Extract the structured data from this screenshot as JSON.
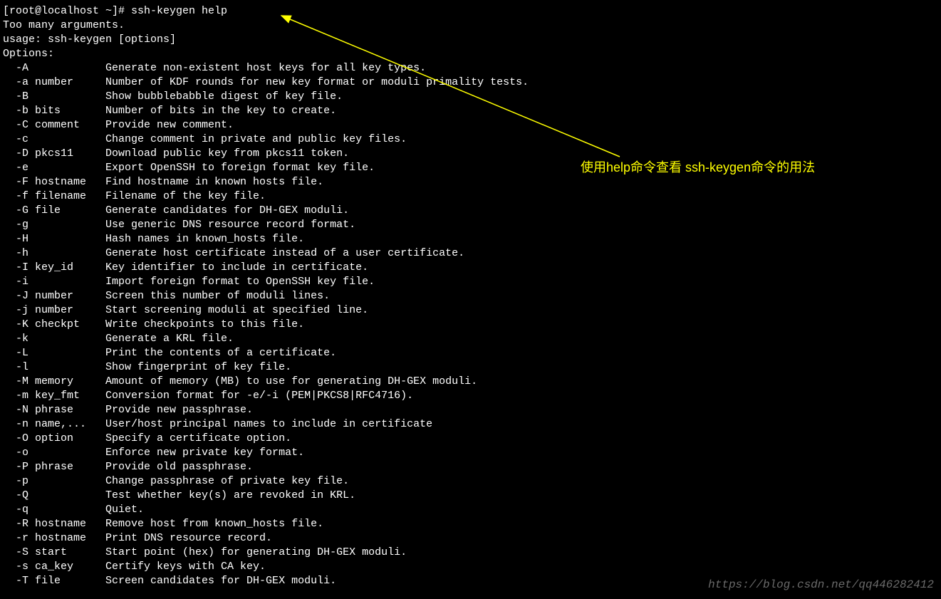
{
  "prompt": "[root@localhost ~]# ",
  "command": "ssh-keygen help",
  "err": "Too many arguments.",
  "usage": "usage: ssh-keygen [options]",
  "optheader": "Options:",
  "options": [
    {
      "flag": "-A",
      "arg": "",
      "desc": "Generate non-existent host keys for all key types."
    },
    {
      "flag": "-a",
      "arg": "number",
      "desc": "Number of KDF rounds for new key format or moduli primality tests."
    },
    {
      "flag": "-B",
      "arg": "",
      "desc": "Show bubblebabble digest of key file."
    },
    {
      "flag": "-b",
      "arg": "bits",
      "desc": "Number of bits in the key to create."
    },
    {
      "flag": "-C",
      "arg": "comment",
      "desc": "Provide new comment."
    },
    {
      "flag": "-c",
      "arg": "",
      "desc": "Change comment in private and public key files."
    },
    {
      "flag": "-D",
      "arg": "pkcs11",
      "desc": "Download public key from pkcs11 token."
    },
    {
      "flag": "-e",
      "arg": "",
      "desc": "Export OpenSSH to foreign format key file."
    },
    {
      "flag": "-F",
      "arg": "hostname",
      "desc": "Find hostname in known hosts file."
    },
    {
      "flag": "-f",
      "arg": "filename",
      "desc": "Filename of the key file."
    },
    {
      "flag": "-G",
      "arg": "file",
      "desc": "Generate candidates for DH-GEX moduli."
    },
    {
      "flag": "-g",
      "arg": "",
      "desc": "Use generic DNS resource record format."
    },
    {
      "flag": "-H",
      "arg": "",
      "desc": "Hash names in known_hosts file."
    },
    {
      "flag": "-h",
      "arg": "",
      "desc": "Generate host certificate instead of a user certificate."
    },
    {
      "flag": "-I",
      "arg": "key_id",
      "desc": "Key identifier to include in certificate."
    },
    {
      "flag": "-i",
      "arg": "",
      "desc": "Import foreign format to OpenSSH key file."
    },
    {
      "flag": "-J",
      "arg": "number",
      "desc": "Screen this number of moduli lines."
    },
    {
      "flag": "-j",
      "arg": "number",
      "desc": "Start screening moduli at specified line."
    },
    {
      "flag": "-K",
      "arg": "checkpt",
      "desc": "Write checkpoints to this file."
    },
    {
      "flag": "-k",
      "arg": "",
      "desc": "Generate a KRL file."
    },
    {
      "flag": "-L",
      "arg": "",
      "desc": "Print the contents of a certificate."
    },
    {
      "flag": "-l",
      "arg": "",
      "desc": "Show fingerprint of key file."
    },
    {
      "flag": "-M",
      "arg": "memory",
      "desc": "Amount of memory (MB) to use for generating DH-GEX moduli."
    },
    {
      "flag": "-m",
      "arg": "key_fmt",
      "desc": "Conversion format for -e/-i (PEM|PKCS8|RFC4716)."
    },
    {
      "flag": "-N",
      "arg": "phrase",
      "desc": "Provide new passphrase."
    },
    {
      "flag": "-n",
      "arg": "name,...",
      "desc": "User/host principal names to include in certificate"
    },
    {
      "flag": "-O",
      "arg": "option",
      "desc": "Specify a certificate option."
    },
    {
      "flag": "-o",
      "arg": "",
      "desc": "Enforce new private key format."
    },
    {
      "flag": "-P",
      "arg": "phrase",
      "desc": "Provide old passphrase."
    },
    {
      "flag": "-p",
      "arg": "",
      "desc": "Change passphrase of private key file."
    },
    {
      "flag": "-Q",
      "arg": "",
      "desc": "Test whether key(s) are revoked in KRL."
    },
    {
      "flag": "-q",
      "arg": "",
      "desc": "Quiet."
    },
    {
      "flag": "-R",
      "arg": "hostname",
      "desc": "Remove host from known_hosts file."
    },
    {
      "flag": "-r",
      "arg": "hostname",
      "desc": "Print DNS resource record."
    },
    {
      "flag": "-S",
      "arg": "start",
      "desc": "Start point (hex) for generating DH-GEX moduli."
    },
    {
      "flag": "-s",
      "arg": "ca_key",
      "desc": "Certify keys with CA key."
    },
    {
      "flag": "-T",
      "arg": "file",
      "desc": "Screen candidates for DH-GEX moduli."
    }
  ],
  "annotation": "使用help命令查看 ssh-keygen命令的用法",
  "watermark": "https://blog.csdn.net/qq446282412",
  "arrow_color": "#ffff00"
}
